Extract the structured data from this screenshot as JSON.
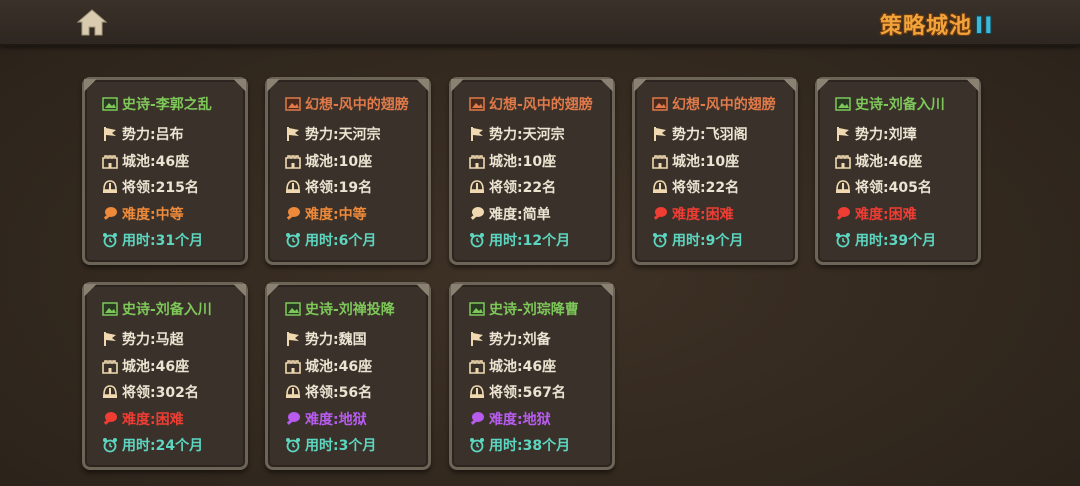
{
  "header": {
    "logo_text": "策略城池",
    "logo_suffix": "II"
  },
  "labels": {
    "force": "势力: ",
    "cities": "城池: ",
    "generals": "将领: ",
    "difficulty": "难度: ",
    "time": "用时: "
  },
  "colors": {
    "epic": "#7ec85a",
    "fantasy": "#e07a4a",
    "medium": "#ef8a3a",
    "hard": "#ef3d34",
    "hell": "#b85cf0",
    "time": "#5cd6c0"
  },
  "cards": [
    {
      "title": "史诗-李郭之乱",
      "category": "epic",
      "force": "吕布",
      "cities": "46座",
      "generals": "215名",
      "difficulty": "中等",
      "difficulty_level": "medium",
      "time": "31个月"
    },
    {
      "title": "幻想-风中的翅膀",
      "category": "fantasy",
      "force": "天河宗",
      "cities": "10座",
      "generals": "19名",
      "difficulty": "中等",
      "difficulty_level": "medium",
      "time": "6个月"
    },
    {
      "title": "幻想-风中的翅膀",
      "category": "fantasy",
      "force": "天河宗",
      "cities": "10座",
      "generals": "22名",
      "difficulty": "简单",
      "difficulty_level": "easy",
      "time": "12个月"
    },
    {
      "title": "幻想-风中的翅膀",
      "category": "fantasy",
      "force": "飞羽阁",
      "cities": "10座",
      "generals": "22名",
      "difficulty": "困难",
      "difficulty_level": "hard",
      "time": "9个月"
    },
    {
      "title": "史诗-刘备入川",
      "category": "epic",
      "force": "刘璋",
      "cities": "46座",
      "generals": "405名",
      "difficulty": "困难",
      "difficulty_level": "hard",
      "time": "39个月"
    },
    {
      "title": "史诗-刘备入川",
      "category": "epic",
      "force": "马超",
      "cities": "46座",
      "generals": "302名",
      "difficulty": "困难",
      "difficulty_level": "hard",
      "time": "24个月"
    },
    {
      "title": "史诗-刘禅投降",
      "category": "epic",
      "force": "魏国",
      "cities": "46座",
      "generals": "56名",
      "difficulty": "地狱",
      "difficulty_level": "hell",
      "time": "3个月"
    },
    {
      "title": "史诗-刘琮降曹",
      "category": "epic",
      "force": "刘备",
      "cities": "46座",
      "generals": "567名",
      "difficulty": "地狱",
      "difficulty_level": "hell",
      "time": "38个月"
    }
  ]
}
